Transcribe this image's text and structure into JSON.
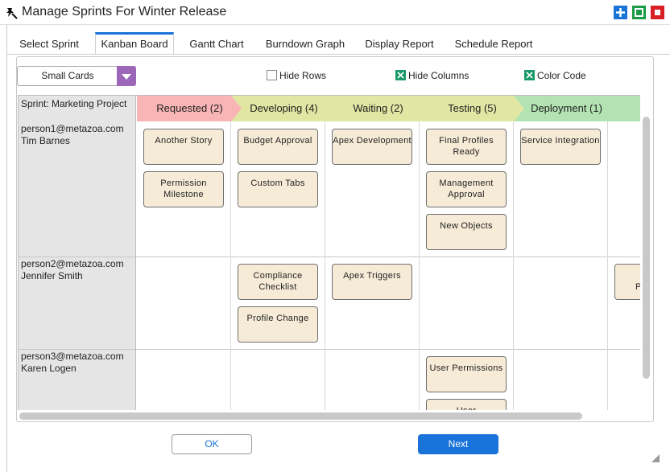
{
  "window": {
    "title": "Manage Sprints For Winter Release",
    "buttons": {
      "add_icon": "plus-icon",
      "max_icon": "maximize-icon",
      "close_icon": "close-icon"
    }
  },
  "tabs": [
    {
      "label": "Select Sprint",
      "active": false
    },
    {
      "label": "Kanban Board",
      "active": true
    },
    {
      "label": "Gantt Chart",
      "active": false
    },
    {
      "label": "Burndown Graph",
      "active": false
    },
    {
      "label": "Display Report",
      "active": false
    },
    {
      "label": "Schedule Report",
      "active": false
    }
  ],
  "toolbar": {
    "card_size": "Small Cards",
    "hide_rows": {
      "label": "Hide Rows",
      "checked": false
    },
    "hide_columns": {
      "label": "Hide Columns",
      "checked": true
    },
    "color_code": {
      "label": "Color Code",
      "checked": true
    }
  },
  "board": {
    "sprint_label": "Sprint: Marketing Project",
    "columns": [
      {
        "label": "Requested (2)",
        "color": "#f9b5b5"
      },
      {
        "label": "Developing (4)",
        "color": "#e2e6a3"
      },
      {
        "label": "Waiting (2)",
        "color": "#e2e6a3"
      },
      {
        "label": "Testing (5)",
        "color": "#e2e6a3"
      },
      {
        "label": "Deployment (1)",
        "color": "#b3e2b3"
      },
      {
        "label": "F",
        "color": "#b3e2b3"
      }
    ],
    "rows": [
      {
        "email": "person1@metazoa.com",
        "name": "Tim Barnes",
        "cells": [
          [
            "Another Story",
            "Permission Milestone"
          ],
          [
            "Budget Approval",
            "Custom Tabs"
          ],
          [
            "Apex Development"
          ],
          [
            "Final Profiles Ready",
            "Management Approval",
            "New Objects"
          ],
          [
            "Service Integration"
          ],
          []
        ]
      },
      {
        "email": "person2@metazoa.com",
        "name": "Jennifer Smith",
        "cells": [
          [],
          [
            "Compliance Checklist",
            "Profile Change"
          ],
          [
            "Apex Triggers"
          ],
          [],
          [],
          [
            "Pe"
          ]
        ]
      },
      {
        "email": "person3@metazoa.com",
        "name": "Karen Logen",
        "cells": [
          [],
          [],
          [],
          [
            "User Permissions",
            "User"
          ],
          [],
          []
        ]
      }
    ]
  },
  "footer": {
    "ok_label": "OK",
    "next_label": "Next"
  },
  "colors": {
    "accent": "#1a73d9",
    "dropdown_caret": "#9c67b8",
    "card_fill": "#f6ebd7"
  }
}
